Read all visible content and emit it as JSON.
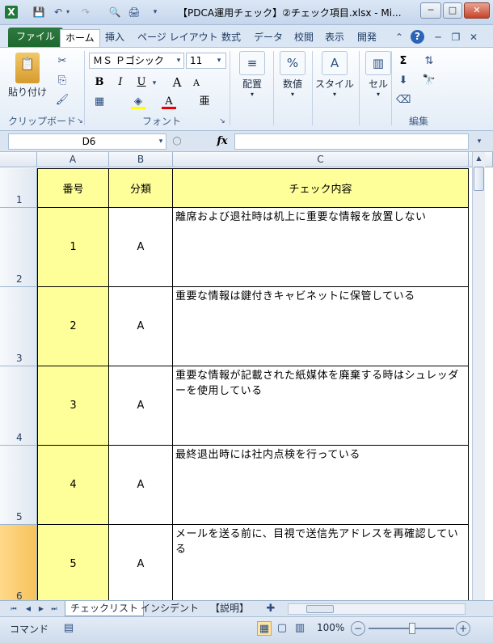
{
  "window": {
    "title": "【PDCA運用チェック】②チェック項目.xlsx - Mi...",
    "app_icon": "excel-icon",
    "minimize_label": "─",
    "maximize_label": "□",
    "close_label": "✕"
  },
  "ribbon_tabs": [
    {
      "label": "ファイル"
    },
    {
      "label": "ホーム"
    },
    {
      "label": "挿入"
    },
    {
      "label": "ページ レイアウト"
    },
    {
      "label": "数式"
    },
    {
      "label": "データ"
    },
    {
      "label": "校閲"
    },
    {
      "label": "表示"
    },
    {
      "label": "開発"
    }
  ],
  "ribbon": {
    "clipboard": {
      "paste_label": "貼り付け",
      "group_label": "クリップボード"
    },
    "font": {
      "font_name": "ＭＳ Ｐゴシック",
      "font_size": "11",
      "group_label": "フォント",
      "bold": "B",
      "italic": "I",
      "underline": "U",
      "grow": "A",
      "shrink": "A",
      "phonetic": "亜",
      "font_color": "A"
    },
    "alignment": {
      "label": "配置"
    },
    "number": {
      "label": "数値",
      "icon_text": "%"
    },
    "styles": {
      "label": "スタイル"
    },
    "cells": {
      "label": "セル"
    },
    "editing": {
      "group_label": "編集",
      "sum": "Σ"
    }
  },
  "formula_bar": {
    "name_box": "D6",
    "fx": "fx",
    "formula": ""
  },
  "columns": [
    "A",
    "B",
    "C"
  ],
  "header_row": {
    "row_label": "1",
    "a": "番号",
    "b": "分類",
    "c": "チェック内容"
  },
  "rows": [
    {
      "row_label": "2",
      "num": "1",
      "cat": "A",
      "content": "離席および退社時は机上に重要な情報を放置しない"
    },
    {
      "row_label": "3",
      "num": "2",
      "cat": "A",
      "content": "重要な情報は鍵付きキャビネットに保管している"
    },
    {
      "row_label": "4",
      "num": "3",
      "cat": "A",
      "content": "重要な情報が記載された紙媒体を廃棄する時はシュレッダーを使用している"
    },
    {
      "row_label": "5",
      "num": "4",
      "cat": "A",
      "content": "最終退出時には社内点検を行っている"
    },
    {
      "row_label": "6",
      "num": "5",
      "cat": "A",
      "content": "メールを送る前に、目視で送信先アドレスを再確認している"
    }
  ],
  "sheet_tabs": [
    {
      "label": "チェックリスト"
    },
    {
      "label": "インシデント"
    },
    {
      "label": "【説明】"
    }
  ],
  "status": {
    "mode": "コマンド",
    "zoom": "100%"
  },
  "colors": {
    "header_yellow": "#ffff99",
    "selected_row": "#ffcc66",
    "file_tab": "#1f6830"
  }
}
